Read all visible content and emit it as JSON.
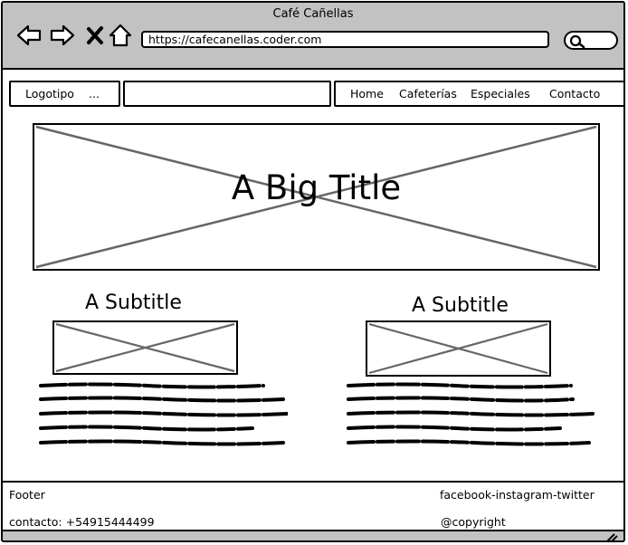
{
  "window": {
    "title": "Café Cañellas"
  },
  "browser": {
    "url": "https://cafecanellas.coder.com",
    "back_icon": "back-arrow-icon",
    "forward_icon": "forward-arrow-icon",
    "close_icon": "close-icon",
    "home_icon": "home-icon",
    "search_icon": "search-icon"
  },
  "header": {
    "logo_label": "Logotipo",
    "logo_dots": "...",
    "nav": [
      "Home",
      "Cafeterías",
      "Especiales",
      "Contacto"
    ]
  },
  "hero": {
    "title": "A Big Title"
  },
  "sections": [
    {
      "subtitle": "A Subtitle"
    },
    {
      "subtitle": "A Subtitle"
    }
  ],
  "footer": {
    "label": "Footer",
    "social": "facebook-instagram-twitter",
    "contact": "contacto: +54915444499",
    "copyright": "@copyright"
  },
  "colors": {
    "chrome": "#c2c2c2",
    "placeholder_line": "#666666"
  }
}
